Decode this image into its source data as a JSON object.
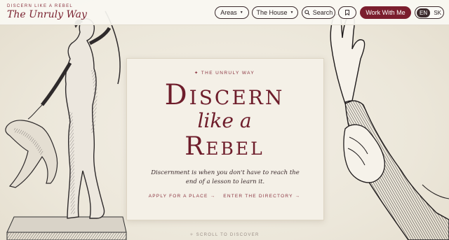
{
  "header": {
    "logo_tagline": "DISCERN LIKE A REBEL",
    "logo_name": "The Unruly Way",
    "nav": {
      "areas_label": "Areas",
      "house_label": "The House",
      "search_label": "Search",
      "cta_label": "Work With Me"
    },
    "lang": {
      "active": "EN",
      "other": "SK"
    }
  },
  "hero": {
    "eyebrow": "✦ THE UNRULY WAY",
    "line1": "Discern",
    "line2": "like a",
    "line3": "Rebel",
    "lede": "Discernment is when you don't have to reach the end of a lesson to learn it.",
    "link_apply": "APPLY FOR A PLACE →",
    "link_directory": "ENTER THE DIRECTORY →",
    "scroll": "✧ SCROLL TO DISCOVER"
  },
  "icons": {
    "search": "search-icon",
    "bookmark": "bookmark-icon",
    "caret": "chevron-down-icon"
  },
  "colors": {
    "accent": "#7b1e2e",
    "background": "#efebe0",
    "ink": "#2c2224"
  }
}
